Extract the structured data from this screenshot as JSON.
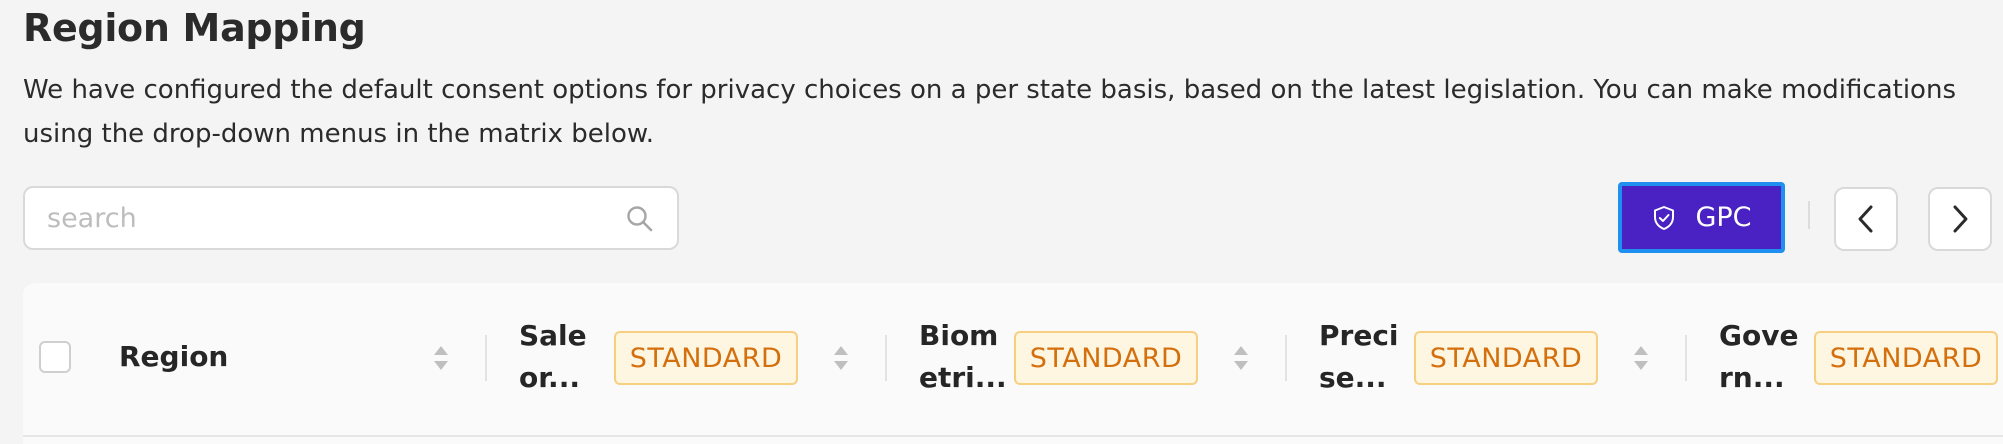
{
  "header": {
    "title": "Region Mapping",
    "description": "We have configured the default consent options for privacy choices on a per state basis, based on the latest legislation. You can make modifications using the drop-down menus in the matrix below."
  },
  "search": {
    "placeholder": "search",
    "value": "",
    "icon": "search-icon"
  },
  "toolbar": {
    "gpc_label": "GPC",
    "gpc_icon": "shield-check-icon",
    "prev_icon": "chevron-left-icon",
    "next_icon": "chevron-right-icon",
    "accent_color": "#4a21c2",
    "focus_color": "#1f8ff0"
  },
  "table": {
    "columns": [
      {
        "label": "Region"
      },
      {
        "label_line1": "Sale",
        "label_line2": "or...",
        "badge": "STANDARD"
      },
      {
        "label_line1": "Biom",
        "label_line2": "etri...",
        "badge": "STANDARD"
      },
      {
        "label_line1": "Preci",
        "label_line2": "se...",
        "badge": "STANDARD"
      },
      {
        "label_line1": "Gove",
        "label_line2": "rn...",
        "badge": "STANDARD"
      }
    ],
    "badge_color": "#d46f0d",
    "badge_bg": "#fff6e2"
  }
}
